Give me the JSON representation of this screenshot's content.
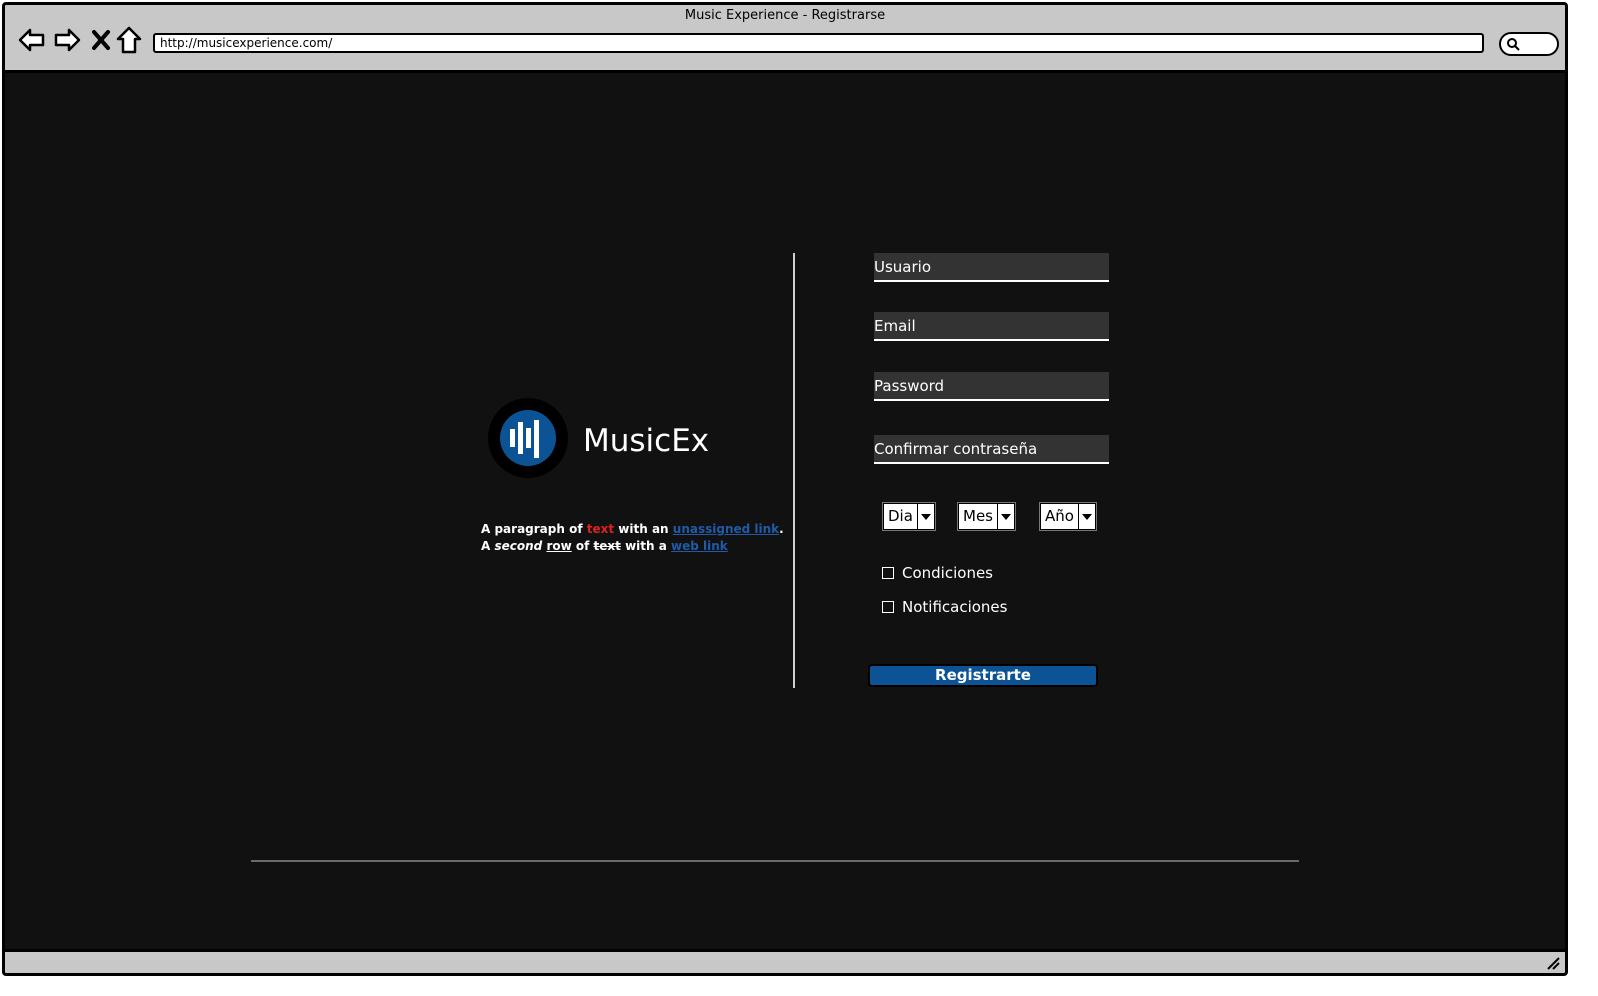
{
  "window": {
    "title": "Music Experience - Registrarse",
    "url": "http://musicexperience.com/"
  },
  "brand": {
    "name": "MusicEx",
    "icon": "equalizer-bars-icon",
    "accent_color": "#0b5394"
  },
  "paragraph": {
    "line1": {
      "a": "A paragraph of",
      "red": "text",
      "b": "with an",
      "link": "unassigned link",
      "end": "."
    },
    "line2": {
      "a": "A",
      "em": "second",
      "u": "row",
      "of": "of",
      "s": "text",
      "b": "with a",
      "link": "web link"
    }
  },
  "form": {
    "username_placeholder": "Usuario",
    "email_placeholder": "Email",
    "password_placeholder": "Password",
    "confirm_placeholder": "Confirmar contraseña",
    "day_value": "Dia",
    "month_value": "Mes",
    "year_value": "Año",
    "terms_label": "Condiciones",
    "notifications_label": "Notificaciones",
    "submit_label": "Registrarte"
  }
}
